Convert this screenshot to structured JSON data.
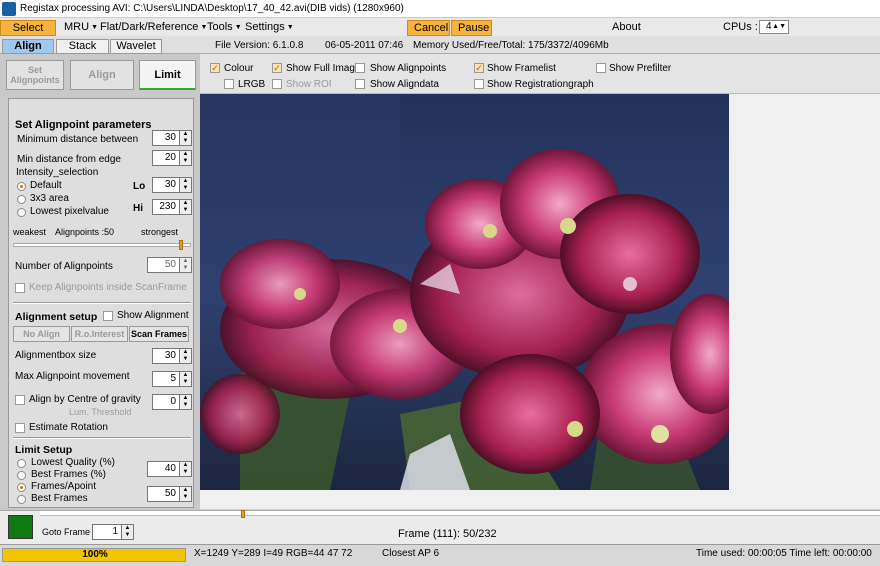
{
  "titlebar": {
    "title": "Registax processing AVI: C:\\Users\\LINDA\\Desktop\\17_40_42.avi(DIB vids) (1280x960)"
  },
  "menubar": {
    "items": [
      "Select",
      "MRU",
      "Flat/Dark/Reference",
      "Tools",
      "Settings"
    ],
    "cancel": "Cancel",
    "pause": "Pause",
    "about": "About",
    "cpus_label": "CPUs :",
    "cpus_value": "4"
  },
  "tabs": {
    "items": [
      "Align",
      "Stack",
      "Wavelet"
    ],
    "active": "Align"
  },
  "info": {
    "file_version": "File Version: 6.1.0.8",
    "date": "06-05-2011 07:46",
    "memory": "Memory Used/Free/Total: 175/3372/4096Mb"
  },
  "left_buttons": {
    "set_alignpoints": "Set Alignpoints",
    "align": "Align",
    "limit": "Limit"
  },
  "alignpoint_params": {
    "heading": "Set Alignpoint parameters",
    "min_distance_between_label": "Minimum distance between",
    "min_distance_between_value": "30",
    "min_distance_edge_label": "Min distance from edge",
    "min_distance_edge_value": "20",
    "intensity_group": "Intensity_selection",
    "options": [
      "Default",
      "3x3 area",
      "Lowest pixelvalue"
    ],
    "selected_option": "Default",
    "lo_label": "Lo",
    "lo_value": "30",
    "hi_label": "Hi",
    "hi_value": "230",
    "weakest": "weakest",
    "alignpoints_count": "Alignpoints :50",
    "strongest": "strongest",
    "slider_level": 0.95,
    "num_alignpoints_label": "Number of Alignpoints",
    "num_alignpoints_value": "50",
    "keep_inside_label": "Keep Alignpoints inside ScanFrame"
  },
  "alignment_setup": {
    "heading": "Alignment setup",
    "show_alignment": "Show Alignment",
    "no_align": "No Align",
    "roi": "R.o.Interest",
    "scan_frames": "Scan Frames",
    "box_size_label": "Alignmentbox size",
    "box_size_value": "30",
    "max_movement_label": "Max Alignpoint movement",
    "max_movement_value": "5",
    "centre_gravity_label": "Align by Centre of gravity",
    "centre_gravity_value": "0",
    "lum_threshold": "Lum. Threshold",
    "estimate_rotation": "Estimate Rotation"
  },
  "limit_setup": {
    "heading": "Limit Setup",
    "options": [
      "Lowest Quality (%)",
      "Best Frames (%)",
      "Frames/Apoint",
      "Best Frames"
    ],
    "selected_option": "Frames/Apoint",
    "value_1": "40",
    "value_2": "50"
  },
  "options_bar": {
    "colour": "Colour",
    "lrgb": "LRGB",
    "show_full_image": "Show Full Image",
    "show_roi": "Show ROI",
    "show_alignpoints": "Show Alignpoints",
    "show_aligndata": "Show Aligndata",
    "show_framelist": "Show Framelist",
    "show_registrationgraph": "Show Registrationgraph",
    "show_prefilter": "Show Prefilter"
  },
  "bottom": {
    "goto_frame_label": "Goto Frame",
    "goto_frame_value": "1",
    "frame_info": "Frame (111): 50/232",
    "frame_slider_level": 0.24,
    "color_swatch": "#0e7a10"
  },
  "status": {
    "progress_text": "100%",
    "progress": 1.0,
    "coords": "X=1249 Y=289 I=49 RGB=44 47 72",
    "closest_ap": "Closest AP 6",
    "time": "Time used: 00:00:05 Time left: 00:00:00"
  },
  "colors": {
    "accent_orange": "#f7b33f",
    "active_tab": "#9fc8ec",
    "progress_yellow": "#f5c400"
  }
}
